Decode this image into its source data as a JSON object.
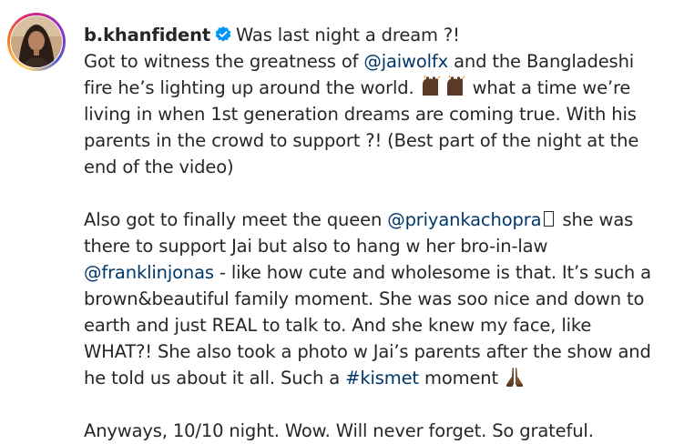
{
  "post": {
    "username": "b.khanfident",
    "verified_icon": "verified-badge-icon",
    "title": "Was last night a dream ?!",
    "p1": {
      "l1_pre": "Got to witness the greatness of ",
      "l1_mention": "@jaiwolfx",
      "l1_post": " and the Bangladeshi",
      "l2_pre": "fire he’s lighting up around the world. ",
      "l2_post": " what a time we’re",
      "l3": "living in when 1st generation dreams are coming true. With his",
      "l4": "parents in the crowd to support ?! (Best part of the night at the",
      "l5": "end of the video)"
    },
    "p2": {
      "l1_pre": "Also got to finally meet the queen ",
      "l1_mention": "@priyankachopra",
      "l1_post": " she was",
      "l2": "there to support Jai but also to hang w her bro-in-law",
      "l3_mention": "@franklinjonas",
      "l3_post": " - like how cute and wholesome is that. It’s such a",
      "l4": "brown&beautiful family moment. She was soo nice and down to",
      "l5": "earth and just REAL to talk to. And she knew my face, like",
      "l6": "WHAT?! She also took a photo w Jai’s parents after the show and",
      "l7": "he told us about it all. Such a ",
      "l7_hashtag": "#kismet",
      "l7_post": " moment "
    },
    "p3": {
      "l1": "Anyways, 10/10 night. Wow. Will never forget. So grateful."
    },
    "icons": {
      "avatar": "avatar",
      "raised_hands": "raised-hands-icon",
      "praying_hands": "folded-hands-icon",
      "missing_glyph": "missing-glyph-icon"
    },
    "colors": {
      "text": "#262626",
      "link": "#00376b",
      "verified": "#0095f6"
    }
  }
}
